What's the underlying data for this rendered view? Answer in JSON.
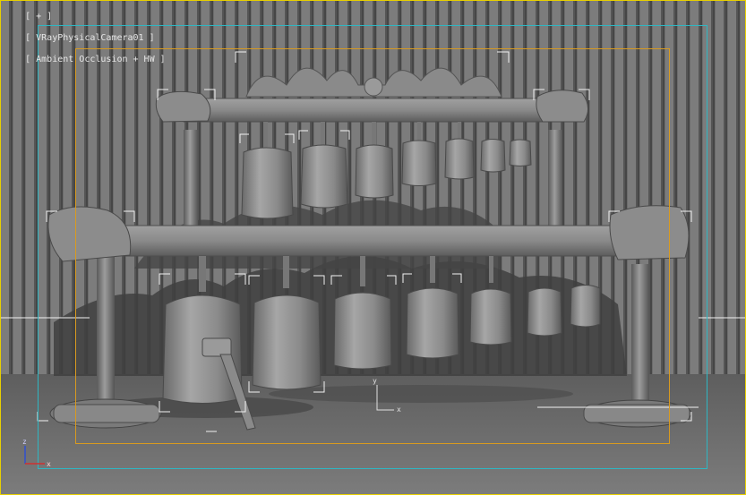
{
  "viewport": {
    "label": {
      "menu": "[ + ]",
      "camera": "[ VRayPhysicalCamera01 ]",
      "shading": "[ Ambient Occlusion + HW ]"
    },
    "colors": {
      "background": "#6e6e6e",
      "active_border": "#e8d000",
      "safe_frame_outer": "#2fb6c2",
      "safe_frame_inner": "#d89a20",
      "gizmo_x": "#d03030",
      "gizmo_y": "#30c030",
      "gizmo_z": "#3050d0"
    },
    "axis_gizmo": {
      "x": "x",
      "z": "z"
    },
    "pivot_gizmo": {
      "x": "x",
      "y": "y"
    }
  }
}
